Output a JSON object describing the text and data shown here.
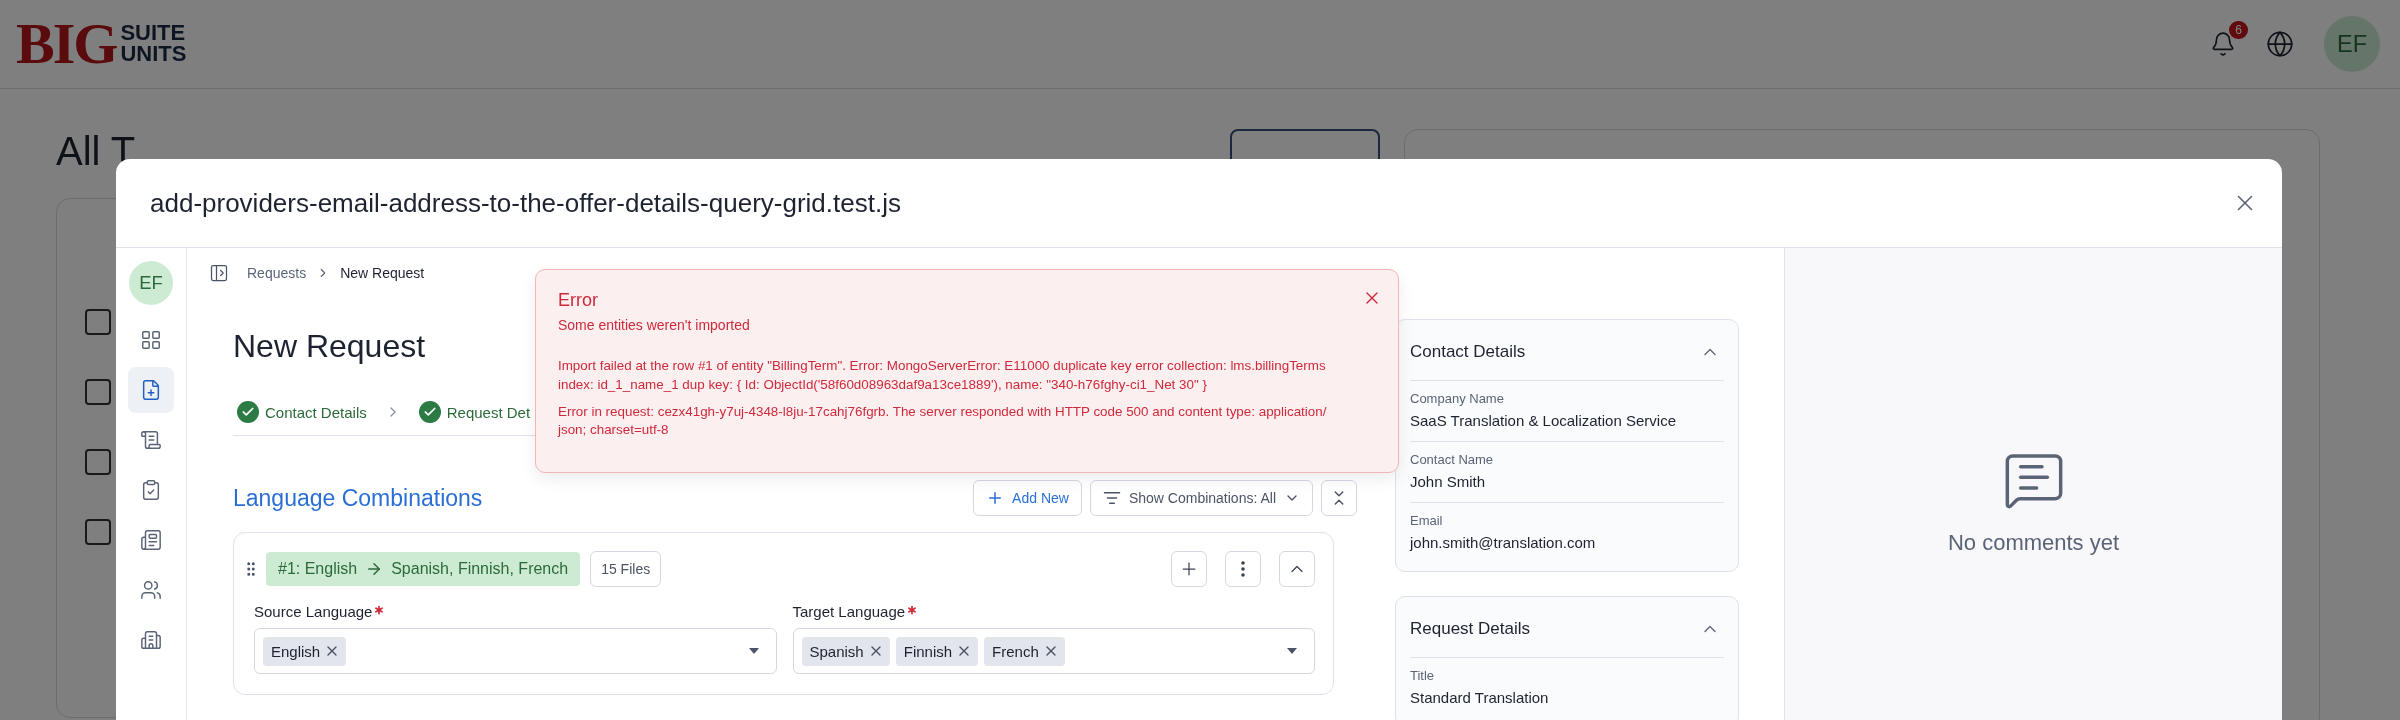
{
  "background": {
    "logo": {
      "big": "BIG",
      "suite": "SUITE",
      "units": "UNITS"
    },
    "notifications_badge": "6",
    "avatar": "EF",
    "page_title": "All T",
    "rows": [
      {
        "checked": false
      },
      {
        "checked": false
      },
      {
        "checked": false
      },
      {
        "checked": false
      }
    ]
  },
  "modal": {
    "title": "add-providers-email-address-to-the-offer-details-query-grid.test.js",
    "sidebar": {
      "avatar": "EF",
      "items": [
        {
          "kind": "dashboard",
          "selected": false
        },
        {
          "kind": "new-request",
          "selected": true
        },
        {
          "kind": "document",
          "selected": false
        },
        {
          "kind": "checklist",
          "selected": false
        },
        {
          "kind": "list",
          "selected": false
        },
        {
          "kind": "users",
          "selected": false
        },
        {
          "kind": "building",
          "selected": false
        }
      ]
    },
    "breadcrumb": [
      "Requests",
      "New Request"
    ],
    "heading": "New Request",
    "steps": [
      {
        "label": "Contact Details",
        "done": true
      },
      {
        "label": "Request Det",
        "done": true
      }
    ],
    "error": {
      "title": "Error",
      "subtitle": "Some entities weren't imported",
      "messages": [
        "Import failed at the row #1 of entity \"BillingTerm\". Error: MongoServerError: E11000 duplicate key error collection: lms.billingTerms index: id_1_name_1 dup key: { Id: ObjectId('58f60d08963daf9a13ce1889'), name: \"340-h76fghy-ci1_Net 30\" }",
        "Error in request: cezx41gh-y7uj-4348-l8ju-17cahj76fgrb. The server responded with HTTP code 500 and content type: application/ json; charset=utf-8"
      ]
    },
    "section_title": "Language Combinations",
    "actions": {
      "add": "Add New",
      "filter": "Show Combinations: All"
    },
    "combination": {
      "source_text": "#1: English",
      "targets_text": "Spanish,  Finnish, French",
      "files": "15 Files",
      "expanded": true,
      "source": {
        "label": "Source Language",
        "required": true,
        "tags": [
          "English"
        ]
      },
      "target": {
        "label": "Target Language",
        "required": true,
        "tags": [
          "Spanish",
          "Finnish",
          "French"
        ]
      }
    },
    "cards": [
      {
        "title": "Contact Details",
        "expanded": true,
        "fields": [
          {
            "label": "Company Name",
            "value": "SaaS Translation & Localization Service"
          },
          {
            "label": "Contact Name",
            "value": "John Smith"
          },
          {
            "label": "Email",
            "value": "john.smith@translation.com"
          }
        ]
      },
      {
        "title": "Request Details",
        "expanded": true,
        "fields": [
          {
            "label": "Title",
            "value": "Standard Translation"
          }
        ]
      }
    ],
    "comments": {
      "empty_text": "No comments yet"
    }
  }
}
